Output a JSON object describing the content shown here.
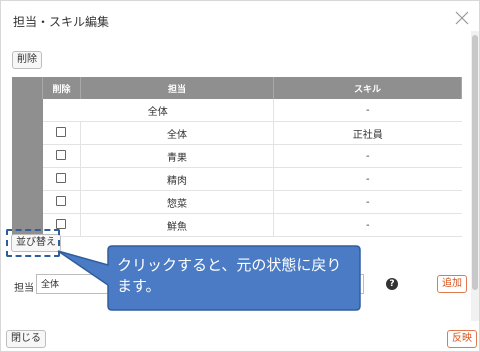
{
  "dialog": {
    "title": "担当・スキル編集"
  },
  "toolbar": {
    "delete_label": "削除"
  },
  "table": {
    "headers": {
      "delete": "削除",
      "owner": "担当",
      "skill": "スキル"
    },
    "rows": [
      {
        "owner": "全体",
        "skill": "-",
        "has_checkbox": false
      },
      {
        "owner": "全体",
        "skill": "正社員",
        "has_checkbox": true
      },
      {
        "owner": "青果",
        "skill": "-",
        "has_checkbox": true
      },
      {
        "owner": "精肉",
        "skill": "-",
        "has_checkbox": true
      },
      {
        "owner": "惣菜",
        "skill": "-",
        "has_checkbox": true
      },
      {
        "owner": "鮮魚",
        "skill": "-",
        "has_checkbox": true
      }
    ]
  },
  "sort_button": {
    "label": "並び替え"
  },
  "form": {
    "owner_label": "担当",
    "owner_value": "全体",
    "help_icon": "question-circle-icon",
    "add_label": "追加"
  },
  "callout": {
    "text_line1": "クリックすると、元の状態に戻り",
    "text_line2": "ます。",
    "fill": "#4a7bc4",
    "stroke": "#2f5e9e"
  },
  "footer": {
    "close_label": "閉じる",
    "apply_label": "反映"
  },
  "colors": {
    "header": "#8f8f8f",
    "accent": "#d9531e"
  }
}
